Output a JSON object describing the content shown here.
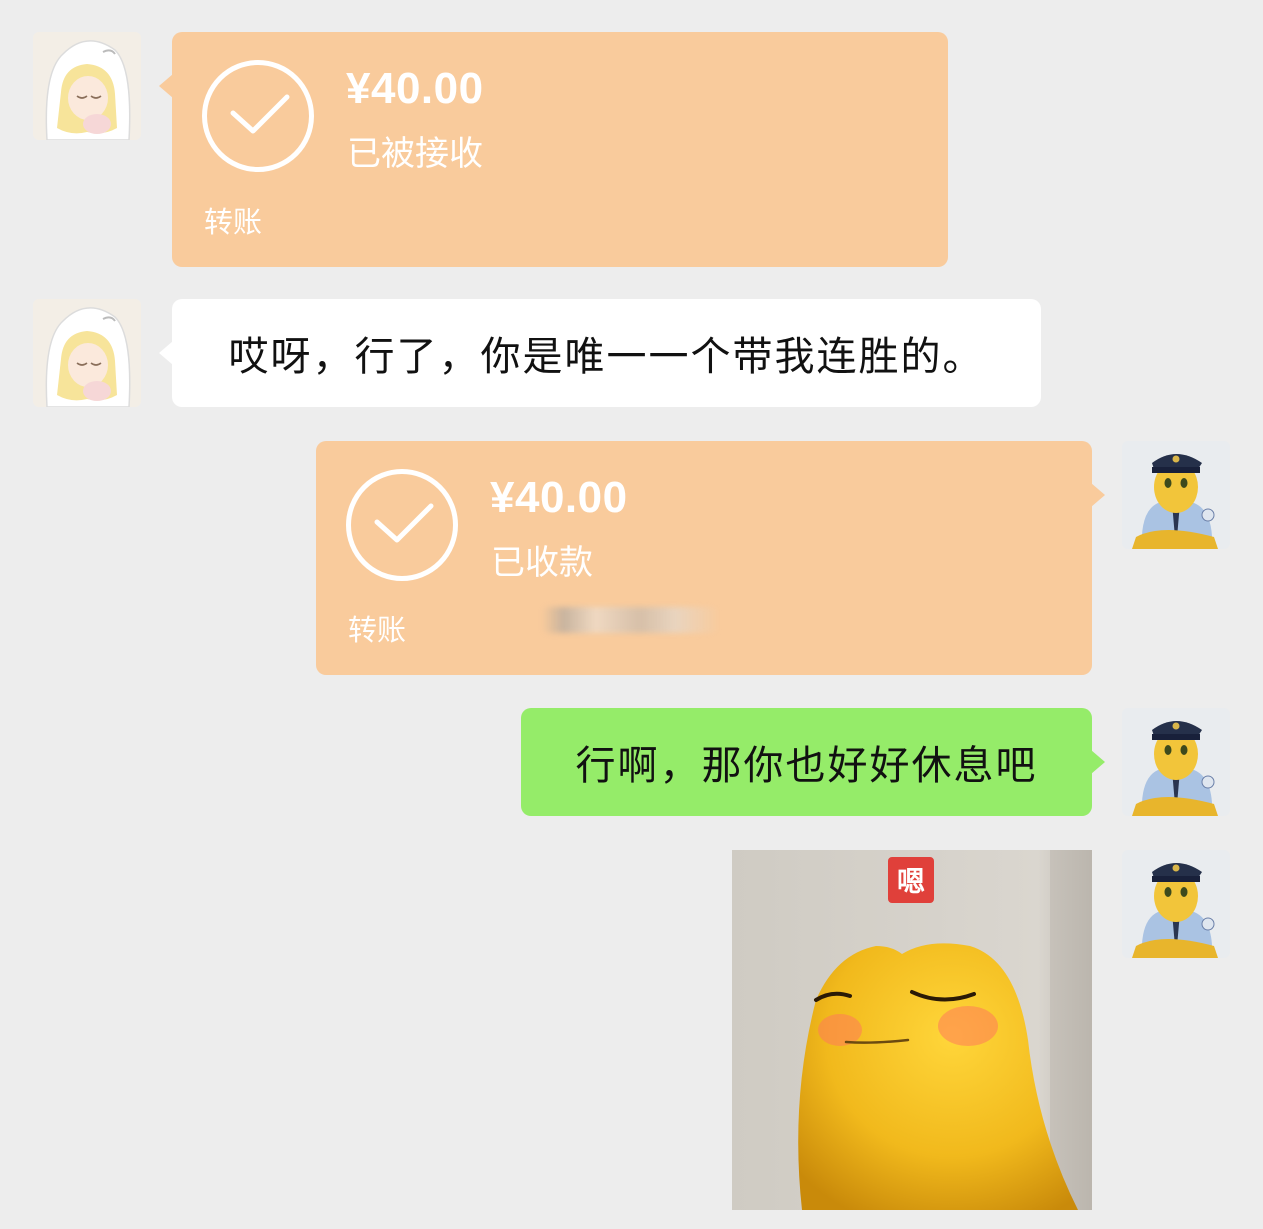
{
  "messages": {
    "m1": {
      "sender": "other",
      "type": "transfer",
      "amount": "¥40.00",
      "status": "已被接收",
      "label": "转账"
    },
    "m2": {
      "sender": "other",
      "type": "text",
      "text": "哎呀，行了，你是唯一一个带我连胜的。"
    },
    "m3": {
      "sender": "self",
      "type": "transfer",
      "amount": "¥40.00",
      "status": "已收款",
      "label": "转账"
    },
    "m4": {
      "sender": "self",
      "type": "text",
      "text": "行啊，那你也好好休息吧"
    },
    "m5": {
      "sender": "self",
      "type": "sticker",
      "badge": "嗯"
    }
  },
  "colors": {
    "background": "#ededed",
    "transfer_bubble": "#f9cb9c",
    "self_bubble": "#95ec69",
    "other_bubble": "#ffffff",
    "sticker_badge": "#e0403a"
  },
  "icons": {
    "transfer_status": "check-circle-icon",
    "other_avatar": "anime-girl-avatar",
    "self_avatar": "police-character-avatar"
  }
}
